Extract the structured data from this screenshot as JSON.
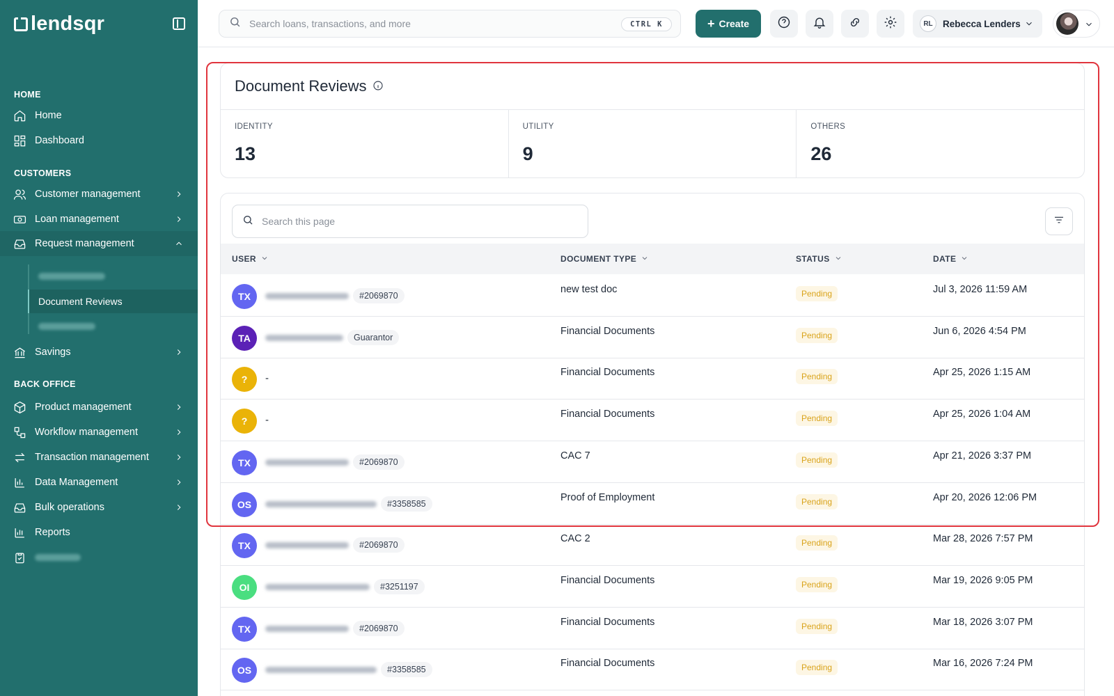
{
  "brand": {
    "name": "lendsqr"
  },
  "sidebar": {
    "sections": {
      "home": "HOME",
      "customers": "CUSTOMERS",
      "back_office": "BACK OFFICE"
    },
    "items": {
      "home": "Home",
      "dashboard": "Dashboard",
      "customer_management": "Customer management",
      "loan_management": "Loan management",
      "request_management": "Request management",
      "document_reviews": "Document Reviews",
      "savings": "Savings",
      "product_management": "Product management",
      "workflow_management": "Workflow management",
      "transaction_management": "Transaction management",
      "data_management": "Data Management",
      "bulk_operations": "Bulk operations",
      "reports": "Reports"
    }
  },
  "topbar": {
    "search_placeholder": "Search loans, transactions, and more",
    "shortcut": "CTRL K",
    "create_label": "Create",
    "user_initials": "RL",
    "user_name": "Rebecca Lenders"
  },
  "page": {
    "title": "Document Reviews",
    "stats": [
      {
        "label": "IDENTITY",
        "value": "13"
      },
      {
        "label": "UTILITY",
        "value": "9"
      },
      {
        "label": "OTHERS",
        "value": "26"
      }
    ],
    "search_placeholder": "Search this page",
    "columns": {
      "user": "USER",
      "document_type": "DOCUMENT TYPE",
      "status": "STATUS",
      "date": "DATE"
    },
    "rows": [
      {
        "initials": "TX",
        "color": "#6366f1",
        "tag": "#2069870",
        "doc": "new test doc",
        "status": "Pending",
        "date": "Jul 3, 2026 11:59 AM"
      },
      {
        "initials": "TA",
        "color": "#5b21b6",
        "tag": "Guarantor",
        "doc": "Financial Documents",
        "status": "Pending",
        "date": "Jun 6, 2026 4:54 PM"
      },
      {
        "initials": "?",
        "color": "#eab308",
        "name_text": "-",
        "doc": "Financial Documents",
        "status": "Pending",
        "date": "Apr 25, 2026 1:15 AM"
      },
      {
        "initials": "?",
        "color": "#eab308",
        "name_text": "-",
        "doc": "Financial Documents",
        "status": "Pending",
        "date": "Apr 25, 2026 1:04 AM"
      },
      {
        "initials": "TX",
        "color": "#6366f1",
        "tag": "#2069870",
        "doc": "CAC 7",
        "status": "Pending",
        "date": "Apr 21, 2026 3:37 PM"
      },
      {
        "initials": "OS",
        "color": "#6366f1",
        "tag": "#3358585",
        "doc": "Proof of Employment",
        "status": "Pending",
        "date": "Apr 20, 2026 12:06 PM"
      },
      {
        "initials": "TX",
        "color": "#6366f1",
        "tag": "#2069870",
        "doc": "CAC 2",
        "status": "Pending",
        "date": "Mar 28, 2026 7:57 PM"
      },
      {
        "initials": "OI",
        "color": "#4ade80",
        "tag": "#3251197",
        "doc": "Financial Documents",
        "status": "Pending",
        "date": "Mar 19, 2026 9:05 PM"
      },
      {
        "initials": "TX",
        "color": "#6366f1",
        "tag": "#2069870",
        "doc": "Financial Documents",
        "status": "Pending",
        "date": "Mar 18, 2026 3:07 PM"
      },
      {
        "initials": "OS",
        "color": "#6366f1",
        "tag": "#3358585",
        "doc": "Financial Documents",
        "status": "Pending",
        "date": "Mar 16, 2026 7:24 PM"
      }
    ]
  }
}
